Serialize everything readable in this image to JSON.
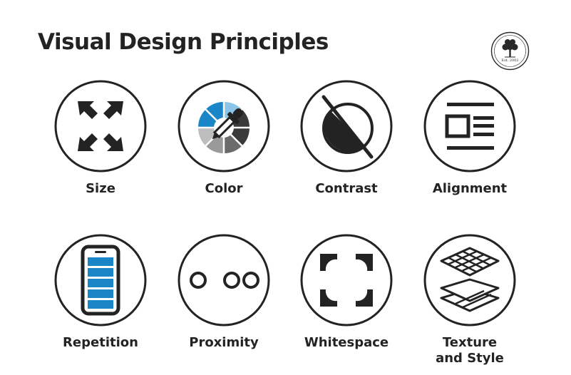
{
  "title": "Visual Design Principles",
  "logo": {
    "text": "Est. 2002"
  },
  "principles": [
    {
      "label": "Size",
      "icon": "expand-arrows-icon"
    },
    {
      "label": "Color",
      "icon": "color-wheel-eyedropper-icon"
    },
    {
      "label": "Contrast",
      "icon": "contrast-circle-icon"
    },
    {
      "label": "Alignment",
      "icon": "text-layout-icon"
    },
    {
      "label": "Repetition",
      "icon": "phone-stacked-bars-icon"
    },
    {
      "label": "Proximity",
      "icon": "grouped-circles-icon"
    },
    {
      "label": "Whitespace",
      "icon": "frame-corners-icon"
    },
    {
      "label": "Texture\nand Style",
      "icon": "layered-grid-icon"
    }
  ],
  "colors": {
    "ink": "#232323",
    "accent_blue": "#1a86c8",
    "light_blue": "#8cc5e6",
    "grays": [
      "#bdbdbd",
      "#9a9a9a",
      "#6b6b6b",
      "#3a3a3a"
    ]
  }
}
